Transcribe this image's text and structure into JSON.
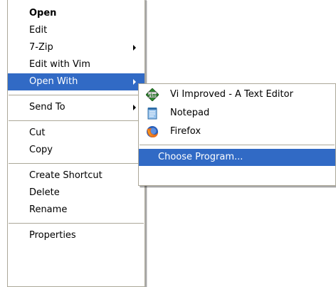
{
  "context_menu": {
    "open": "Open",
    "edit": "Edit",
    "seven_zip": "7-Zip",
    "edit_with_vim": "Edit with Vim",
    "open_with": "Open With",
    "send_to": "Send To",
    "cut": "Cut",
    "copy": "Copy",
    "create_shortcut": "Create Shortcut",
    "delete": "Delete",
    "rename": "Rename",
    "properties": "Properties"
  },
  "submenu": {
    "items": [
      {
        "label": "Vi Improved - A Text Editor",
        "icon": "vim-icon"
      },
      {
        "label": "Notepad",
        "icon": "notepad-icon"
      },
      {
        "label": "Firefox",
        "icon": "firefox-icon"
      }
    ],
    "choose_program": "Choose Program..."
  },
  "colors": {
    "highlight": "#316ac5",
    "separator": "#aca899",
    "menu_background": "#ffffff"
  }
}
